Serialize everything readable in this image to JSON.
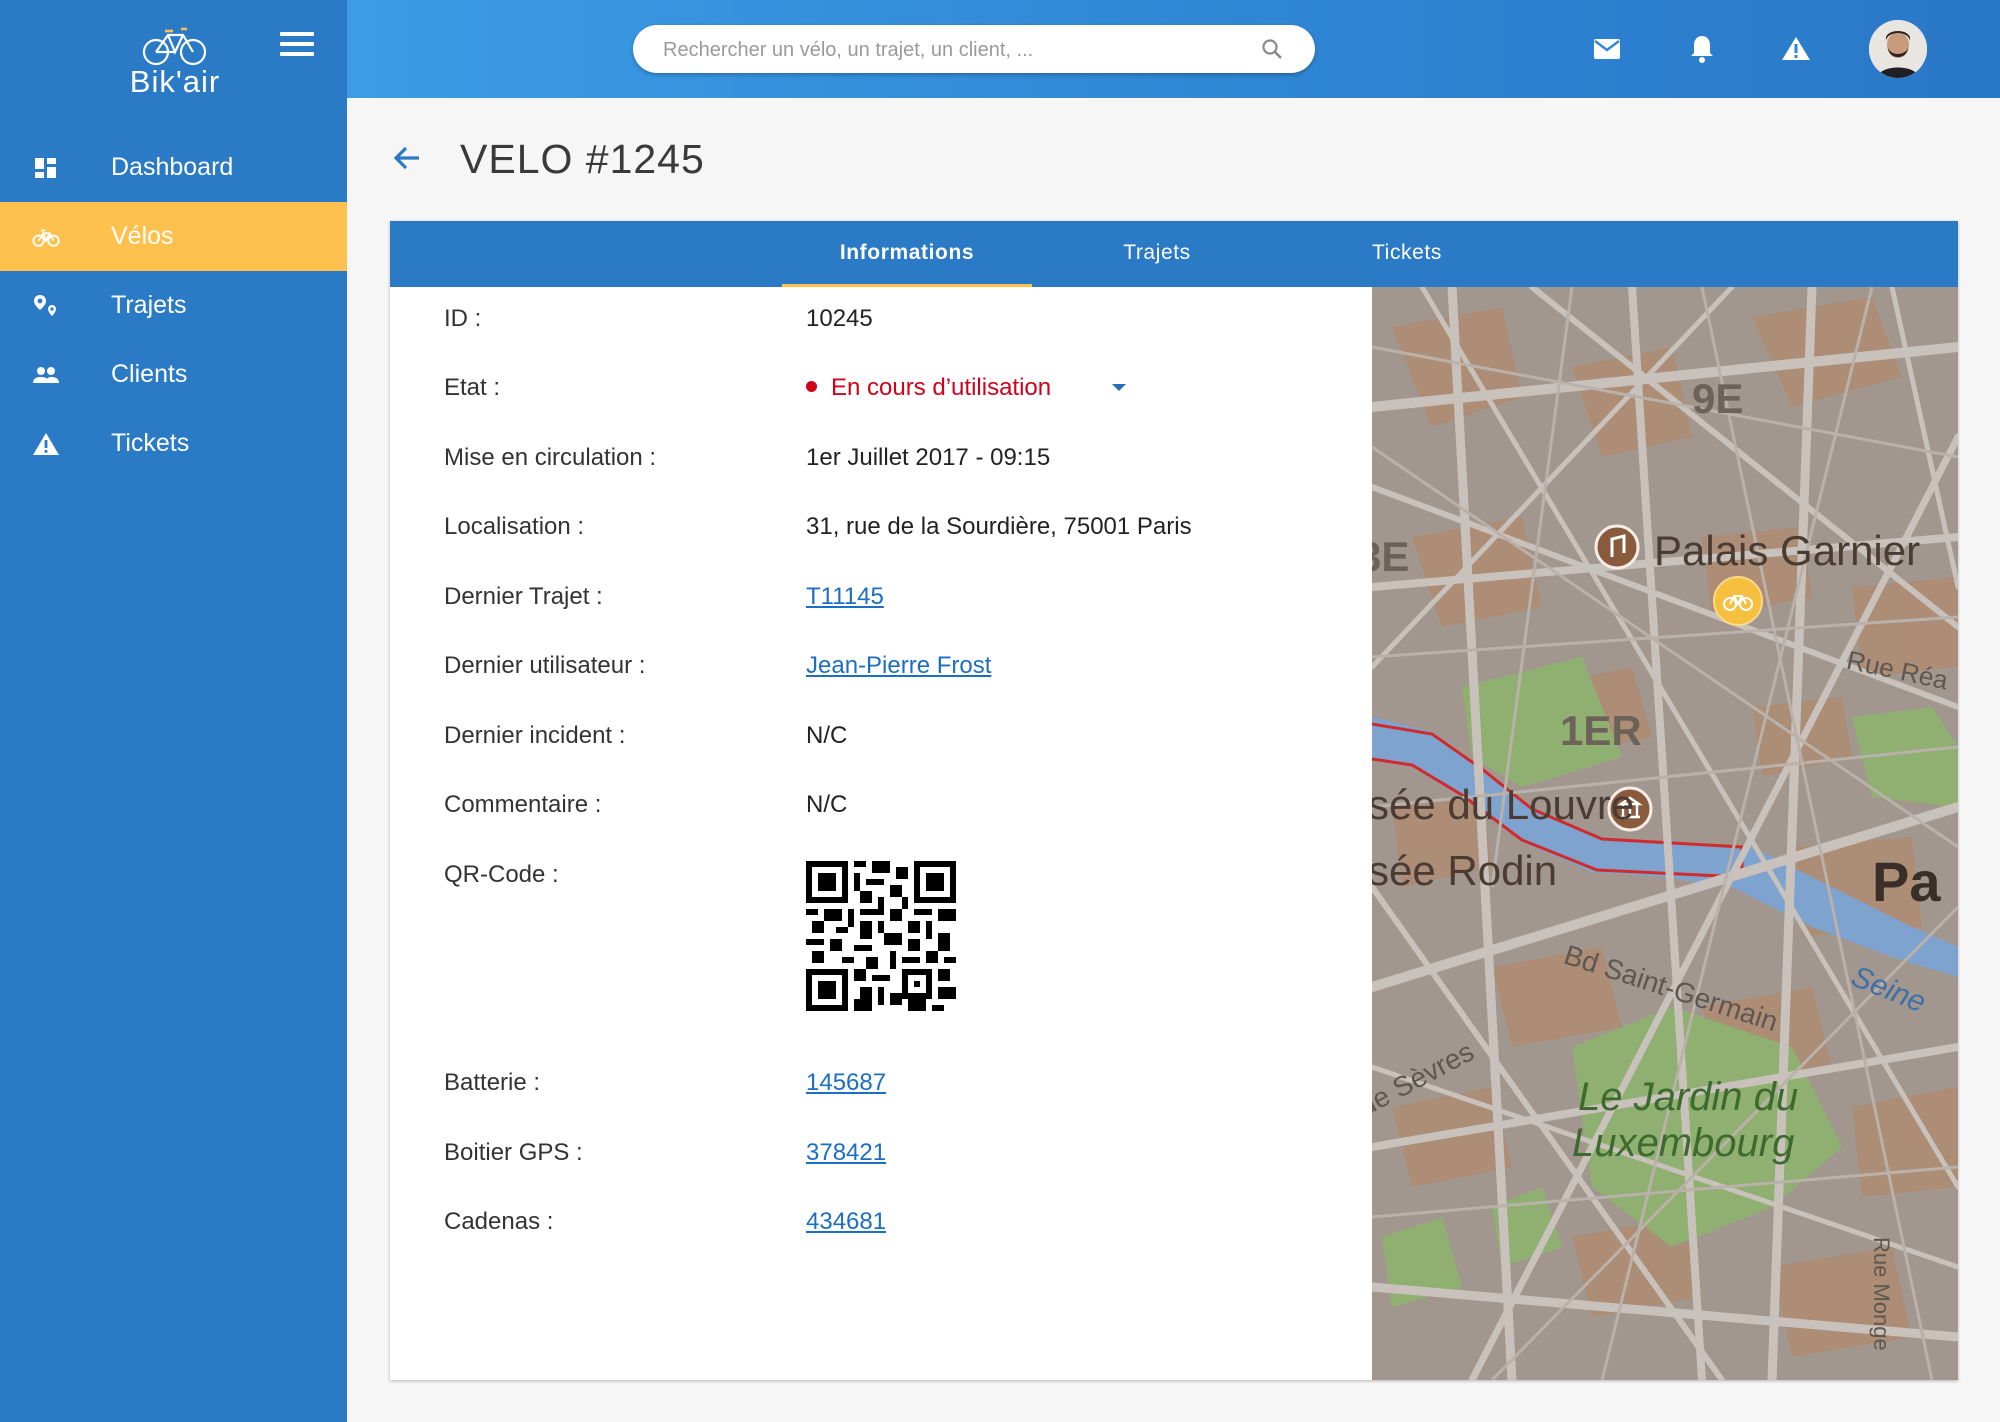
{
  "app": {
    "name": "Bik'air",
    "brand_color": "#2a7ac6",
    "accent_color": "#fec14e"
  },
  "sidebar": {
    "items": [
      {
        "label": "Dashboard",
        "icon": "dashboard-icon"
      },
      {
        "label": "Vélos",
        "icon": "bike-icon",
        "active": true
      },
      {
        "label": "Trajets",
        "icon": "route-pins-icon"
      },
      {
        "label": "Clients",
        "icon": "people-icon"
      },
      {
        "label": "Tickets",
        "icon": "warning-icon"
      }
    ]
  },
  "topbar": {
    "search_placeholder": "Rechercher un vélo, un trajet, un client, ...",
    "icons": [
      "mail-icon",
      "bell-icon",
      "warning-icon",
      "avatar"
    ]
  },
  "page": {
    "title": "VELO #1245"
  },
  "tabs": [
    {
      "label": "Informations",
      "active": true
    },
    {
      "label": "Trajets"
    },
    {
      "label": "Tickets"
    }
  ],
  "details": {
    "id": {
      "label": "ID :",
      "value": "10245"
    },
    "etat": {
      "label": "Etat :",
      "value": "En cours d’utilisation",
      "status_color": "#d0021b"
    },
    "mise": {
      "label": "Mise en circulation :",
      "value": "1er Juillet 2017 - 09:15"
    },
    "localisation": {
      "label": "Localisation :",
      "value": "31, rue de la Sourdière, 75001 Paris"
    },
    "dernier_trajet": {
      "label": "Dernier Trajet :",
      "value": "T11145"
    },
    "dernier_utilisateur": {
      "label": "Dernier utilisateur :",
      "value": "Jean-Pierre Frost"
    },
    "dernier_incident": {
      "label": "Dernier incident :",
      "value": "N/C"
    },
    "commentaire": {
      "label": "Commentaire :",
      "value": "N/C"
    },
    "qr": {
      "label": "QR-Code :"
    },
    "batterie": {
      "label": "Batterie :",
      "value": "145687"
    },
    "gps": {
      "label": "Boitier GPS :",
      "value": "378421"
    },
    "cadenas": {
      "label": "Cadenas :",
      "value": "434681"
    }
  },
  "map": {
    "labels": {
      "arr9": "9E",
      "arr8": "3E",
      "palais": "Palais Garnier",
      "rue_rea": "Rue Réa",
      "arr1": "1ER",
      "louvre": "sée du Louvre",
      "rodin": "sée Rodin",
      "paris": "Pa",
      "bd": "Bd Saint-Germain",
      "seine": "Seine",
      "sevres": "de Sèvres",
      "jardin1": "Le Jardin du",
      "jardin2": "Luxembourg",
      "rue_monge": "Rue Monge"
    }
  }
}
